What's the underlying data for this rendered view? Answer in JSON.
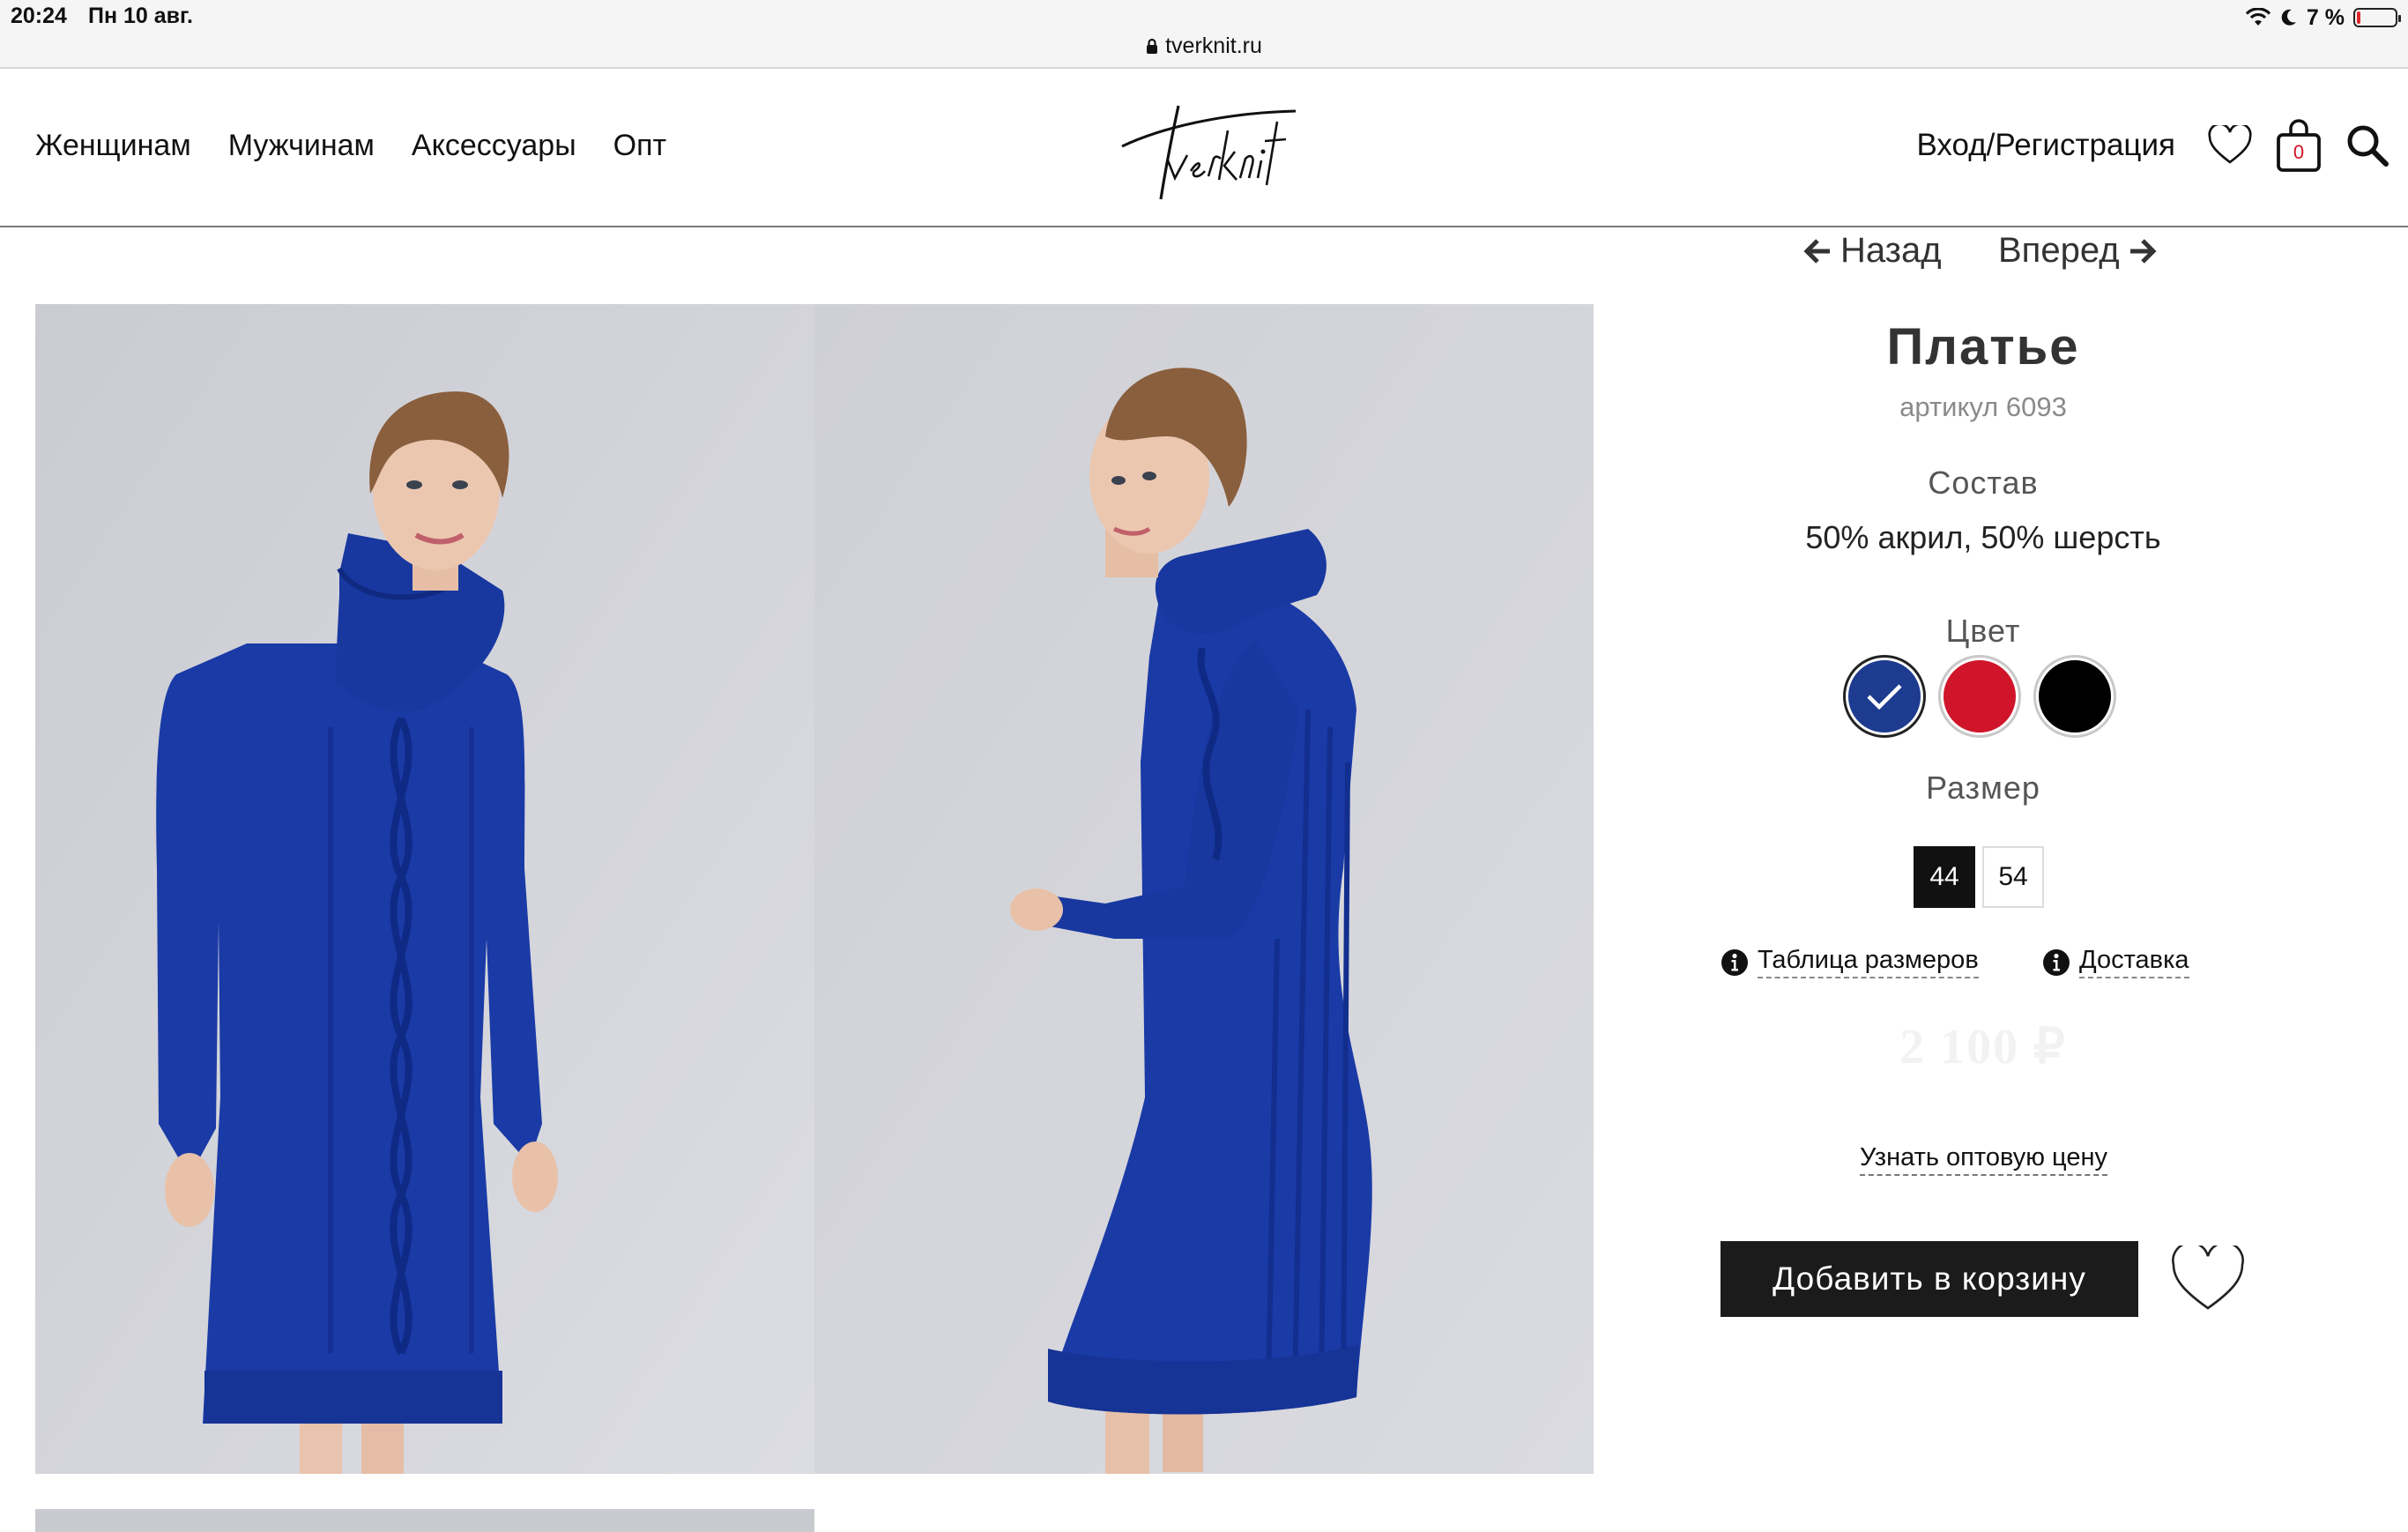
{
  "status_bar": {
    "time": "20:24",
    "date": "Пн 10 авг.",
    "battery_percent": "7 %",
    "url": "tverknit.ru"
  },
  "header": {
    "nav": [
      "Женщинам",
      "Мужчинам",
      "Аксессуары",
      "Опт"
    ],
    "logo_text": "Tverknit",
    "login": "Вход/Регистрация",
    "cart_count": "0"
  },
  "product_nav": {
    "back": "Назад",
    "forward": "Вперед"
  },
  "product": {
    "title": "Платье",
    "article": "артикул 6093",
    "composition_label": "Состав",
    "composition": "50% акрил, 50% шерсть",
    "color_label": "Цвет",
    "colors": [
      {
        "name": "blue",
        "hex": "#1d3b8f",
        "selected": true
      },
      {
        "name": "red",
        "hex": "#d0142a",
        "selected": false
      },
      {
        "name": "black",
        "hex": "#000000",
        "selected": false
      }
    ],
    "size_label": "Размер",
    "sizes": [
      "44",
      "54"
    ],
    "selected_size": "44",
    "size_table_link": "Таблица размеров",
    "delivery_link": "Доставка",
    "price": "2 100 ₽",
    "wholesale_link": "Узнать оптовую цену",
    "add_to_cart": "Добавить в корзину"
  },
  "colors": {
    "dress": "#1a3aa6",
    "photo_bg": "#cfd0d6",
    "button": "#1b1b1b"
  }
}
